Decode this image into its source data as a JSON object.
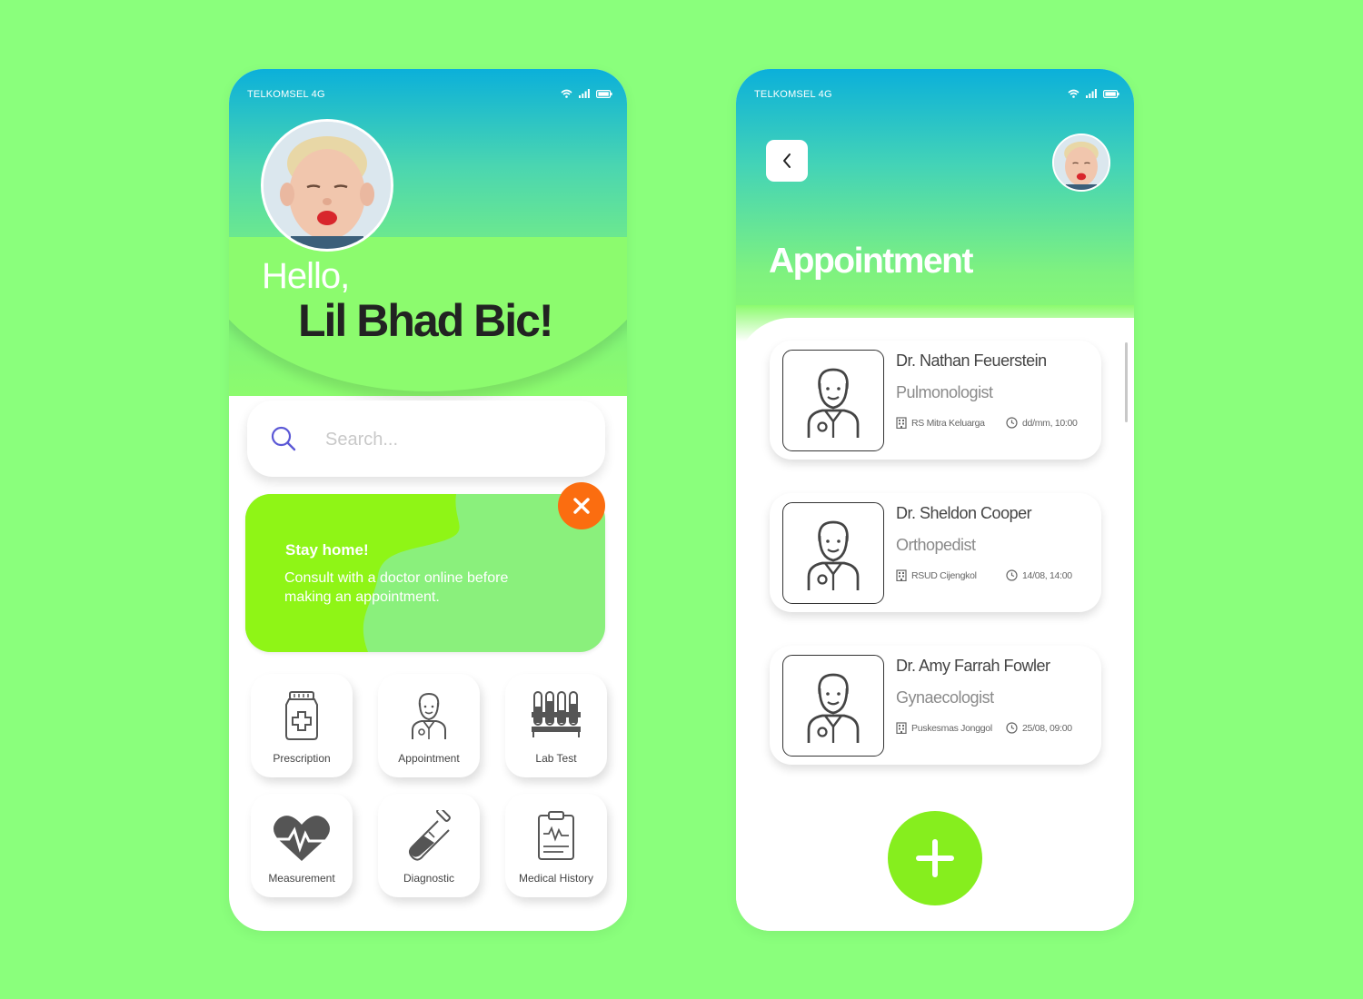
{
  "colors": {
    "background": "#8aff7c",
    "header_top": "#0bb0da",
    "header_bottom": "#8cfb6e",
    "promo": "#8af07c",
    "promo_blob": "#8fef16",
    "close": "#fb6d10",
    "add_button": "#86ee1e"
  },
  "home": {
    "status": {
      "carrier": "TELKOMSEL 4G",
      "icons": [
        "wifi-icon",
        "signal-icon",
        "battery-icon"
      ]
    },
    "greeting": "Hello,",
    "user_name": "Lil Bhad Bic!",
    "search": {
      "placeholder": "Search..."
    },
    "promo": {
      "title": "Stay home!",
      "text": "Consult with a doctor online before making an appointment.",
      "close_icon": "close-icon"
    },
    "menu": [
      {
        "label": "Prescription",
        "icon": "prescription-bottle-icon"
      },
      {
        "label": "Appointment",
        "icon": "doctor-icon"
      },
      {
        "label": "Lab Test",
        "icon": "test-tubes-icon"
      },
      {
        "label": "Measurement",
        "icon": "heartbeat-icon"
      },
      {
        "label": "Diagnostic",
        "icon": "test-tube-icon"
      },
      {
        "label": "Medical History",
        "icon": "clipboard-icon"
      }
    ]
  },
  "appointments": {
    "status": {
      "carrier": "TELKOMSEL 4G"
    },
    "title": "Appointment",
    "back_icon": "chevron-left-icon",
    "items": [
      {
        "doctor": "Dr. Nathan Feuerstein",
        "specialty": "Pulmonologist",
        "location": "RS Mitra Keluarga",
        "time": "dd/mm, 10:00"
      },
      {
        "doctor": "Dr. Sheldon Cooper",
        "specialty": "Orthopedist",
        "location": "RSUD Cijengkol",
        "time": "14/08, 14:00"
      },
      {
        "doctor": "Dr. Amy Farrah Fowler",
        "specialty": "Gynaecologist",
        "location": "Puskesmas Jonggol",
        "time": "25/08, 09:00"
      }
    ],
    "add_icon": "plus-icon"
  }
}
